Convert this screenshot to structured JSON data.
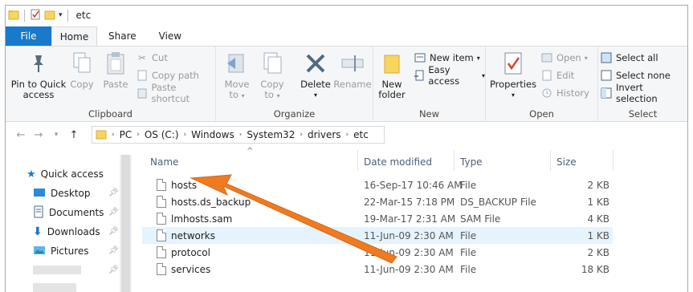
{
  "window": {
    "title": "etc"
  },
  "tabs": [
    "File",
    "Home",
    "Share",
    "View"
  ],
  "ribbon": {
    "clipboard": {
      "label": "Clipboard",
      "pin_line1": "Pin to Quick",
      "pin_line2": "access",
      "copy": "Copy",
      "paste": "Paste",
      "cut": "Cut",
      "copy_path": "Copy path",
      "paste_shortcut": "Paste shortcut"
    },
    "organize": {
      "label": "Organize",
      "move_to_line1": "Move",
      "move_to_line2": "to",
      "copy_to_line1": "Copy",
      "copy_to_line2": "to",
      "delete": "Delete",
      "rename": "Rename"
    },
    "new": {
      "label": "New",
      "new_folder_line1": "New",
      "new_folder_line2": "folder",
      "new_item": "New item",
      "easy_access": "Easy access"
    },
    "open": {
      "label": "Open",
      "properties": "Properties",
      "open": "Open",
      "edit": "Edit",
      "history": "History"
    },
    "select": {
      "label": "Select",
      "select_all": "Select all",
      "select_none": "Select none",
      "invert_selection": "Invert selection"
    }
  },
  "address": {
    "crumbs": [
      "PC",
      "OS (C:)",
      "Windows",
      "System32",
      "drivers",
      "etc"
    ]
  },
  "nav": {
    "items": [
      "Quick access",
      "Desktop",
      "Documents",
      "Downloads",
      "Pictures"
    ]
  },
  "list": {
    "columns": [
      "Name",
      "Date modified",
      "Type",
      "Size"
    ],
    "rows": [
      {
        "name": "hosts",
        "date": "16-Sep-17 10:46 AM",
        "type": "File",
        "size": "2 KB"
      },
      {
        "name": "hosts.ds_backup",
        "date": "22-Mar-15 7:18 PM",
        "type": "DS_BACKUP File",
        "size": "1 KB"
      },
      {
        "name": "lmhosts.sam",
        "date": "19-Mar-17 2:31 AM",
        "type": "SAM File",
        "size": "4 KB"
      },
      {
        "name": "networks",
        "date": "11-Jun-09 2:30 AM",
        "type": "File",
        "size": "1 KB"
      },
      {
        "name": "protocol",
        "date": "11-Jun-09 2:30 AM",
        "type": "File",
        "size": "2 KB"
      },
      {
        "name": "services",
        "date": "11-Jun-09 2:30 AM",
        "type": "File",
        "size": "18 KB"
      }
    ]
  },
  "colors": {
    "accent": "#1979ca",
    "arrow": "#ee7a22",
    "highlight": "#e5f3ff"
  }
}
